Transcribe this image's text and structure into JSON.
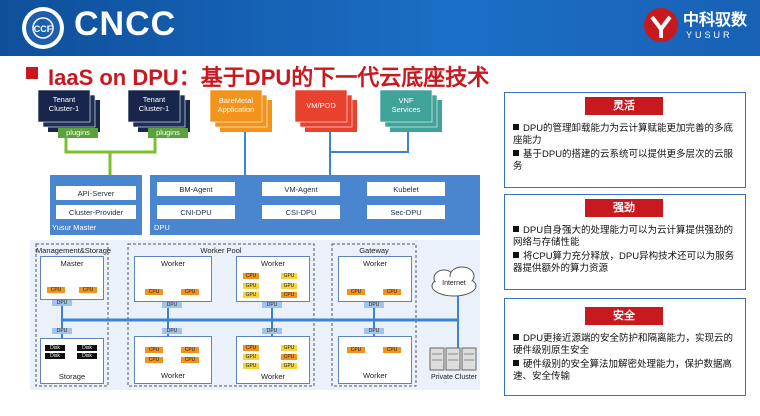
{
  "header": {
    "logo_text": "CNCC",
    "org_logo_text": "CCF",
    "brand_cn": "中科驭数",
    "brand_en": "YUSUR"
  },
  "title": "IaaS on DPU：基于DPU的下一代云底座技术",
  "diagram": {
    "tenant_label": "Tenant\nCluster-1",
    "plugins_label": "plugins",
    "apps": {
      "baremetal": "BareMetal\nApplication",
      "vm": "VM/POD",
      "vnf": "VNF\nServices"
    },
    "yusur_master": {
      "label": "Yusur Master",
      "items": [
        "API-Server",
        "Cluster-Provider"
      ]
    },
    "dpu": {
      "label": "DPU",
      "items": [
        "BM-Agent",
        "CNI-DPU",
        "VM-Agent",
        "CSI-DPU",
        "Kubelet",
        "Sec-DPU"
      ]
    },
    "groups": {
      "mgmt": "Management&Storage",
      "pool": "Worker Pool",
      "gateway": "Gateway"
    },
    "node_labels": {
      "master": "Master",
      "worker": "Worker",
      "storage": "Storage",
      "gateway_worker": "Worker"
    },
    "chip_labels": {
      "cpu": "CPU",
      "dpu": "DPU",
      "gpu": "GPU",
      "disk": "Disk"
    },
    "internet": "Internet",
    "private_cluster": "Private Cluster"
  },
  "panels": [
    {
      "title": "灵活",
      "items": [
        "DPU的管理卸载能力为云计算赋能更加完善的多底座能力",
        "基于DPU的搭建的云系统可以提供更多层次的云服务"
      ]
    },
    {
      "title": "强劲",
      "items": [
        "DPU自身强大的处理能力可以为云计算提供强劲的网络与存储性能",
        "将CPU算力充分释放，DPU异构技术还可以为服务器提供额外的算力资源"
      ]
    },
    {
      "title": "安全",
      "items": [
        "DPU更接近源端的安全防护和隔离能力，实现云的硬件级别原生安全",
        "硬件级别的安全算法加解密处理能力，保护数据高速、安全传输"
      ]
    }
  ],
  "colors": {
    "header": "#1b6fc7",
    "red": "#c8191e",
    "dark_navy": "#17264a",
    "orange": "#f2931c",
    "red_orange": "#e8422f",
    "teal": "#3fa39a",
    "green_line": "#7cbf2f",
    "blue_box": "#4a86d0",
    "light_blue": "#dce8f6",
    "line_blue": "#3b83d8"
  }
}
